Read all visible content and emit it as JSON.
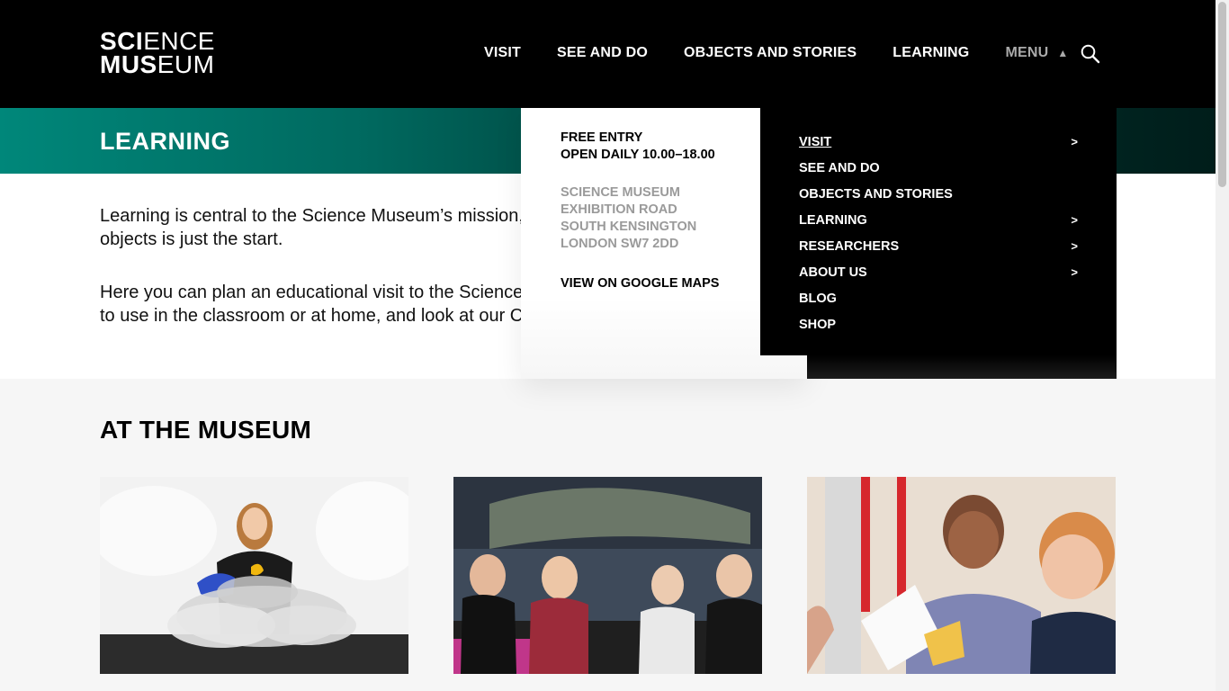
{
  "header": {
    "logo": {
      "line1_bold": "SCI",
      "line1_thin": "ENCE",
      "line2_bold": "MUS",
      "line2_thin": "EUM"
    },
    "nav": [
      {
        "label": "VISIT"
      },
      {
        "label": "SEE AND DO"
      },
      {
        "label": "OBJECTS AND STORIES"
      },
      {
        "label": "LEARNING"
      }
    ],
    "menu_label": "MENU",
    "menu_indicator": "▲",
    "search_icon": "search-icon"
  },
  "band": {
    "title": "LEARNING"
  },
  "intro": {
    "p1": "Learning is central to the Science Museum’s mission, and our world-class collection of objects is just the start.",
    "p2": "Here you can plan an educational visit to the Science Museum, find learning resources to use in the classroom or at home, and look at our CPD opportunities for teachers."
  },
  "dropdown": {
    "entry_line1": "FREE ENTRY",
    "entry_line2": "OPEN DAILY 10.00–18.00",
    "address": [
      "SCIENCE MUSEUM",
      "EXHIBITION ROAD",
      "SOUTH KENSINGTON",
      "LONDON SW7 2DD"
    ],
    "maps_link": "VIEW ON GOOGLE MAPS",
    "menu_items": [
      {
        "label": "VISIT",
        "chevron": ">"
      },
      {
        "label": "SEE AND DO",
        "chevron": ""
      },
      {
        "label": "OBJECTS AND STORIES",
        "chevron": ""
      },
      {
        "label": "LEARNING",
        "chevron": ">"
      },
      {
        "label": "RESEARCHERS",
        "chevron": ">"
      },
      {
        "label": "ABOUT US",
        "chevron": ">"
      },
      {
        "label": "BLOG",
        "chevron": ""
      },
      {
        "label": "SHOP",
        "chevron": ""
      }
    ]
  },
  "section": {
    "title": "AT THE MUSEUM"
  },
  "colors": {
    "band_start": "#00877a",
    "band_end": "#001d1a",
    "header_bg": "#000000",
    "address_gray": "#9a9a9a"
  }
}
